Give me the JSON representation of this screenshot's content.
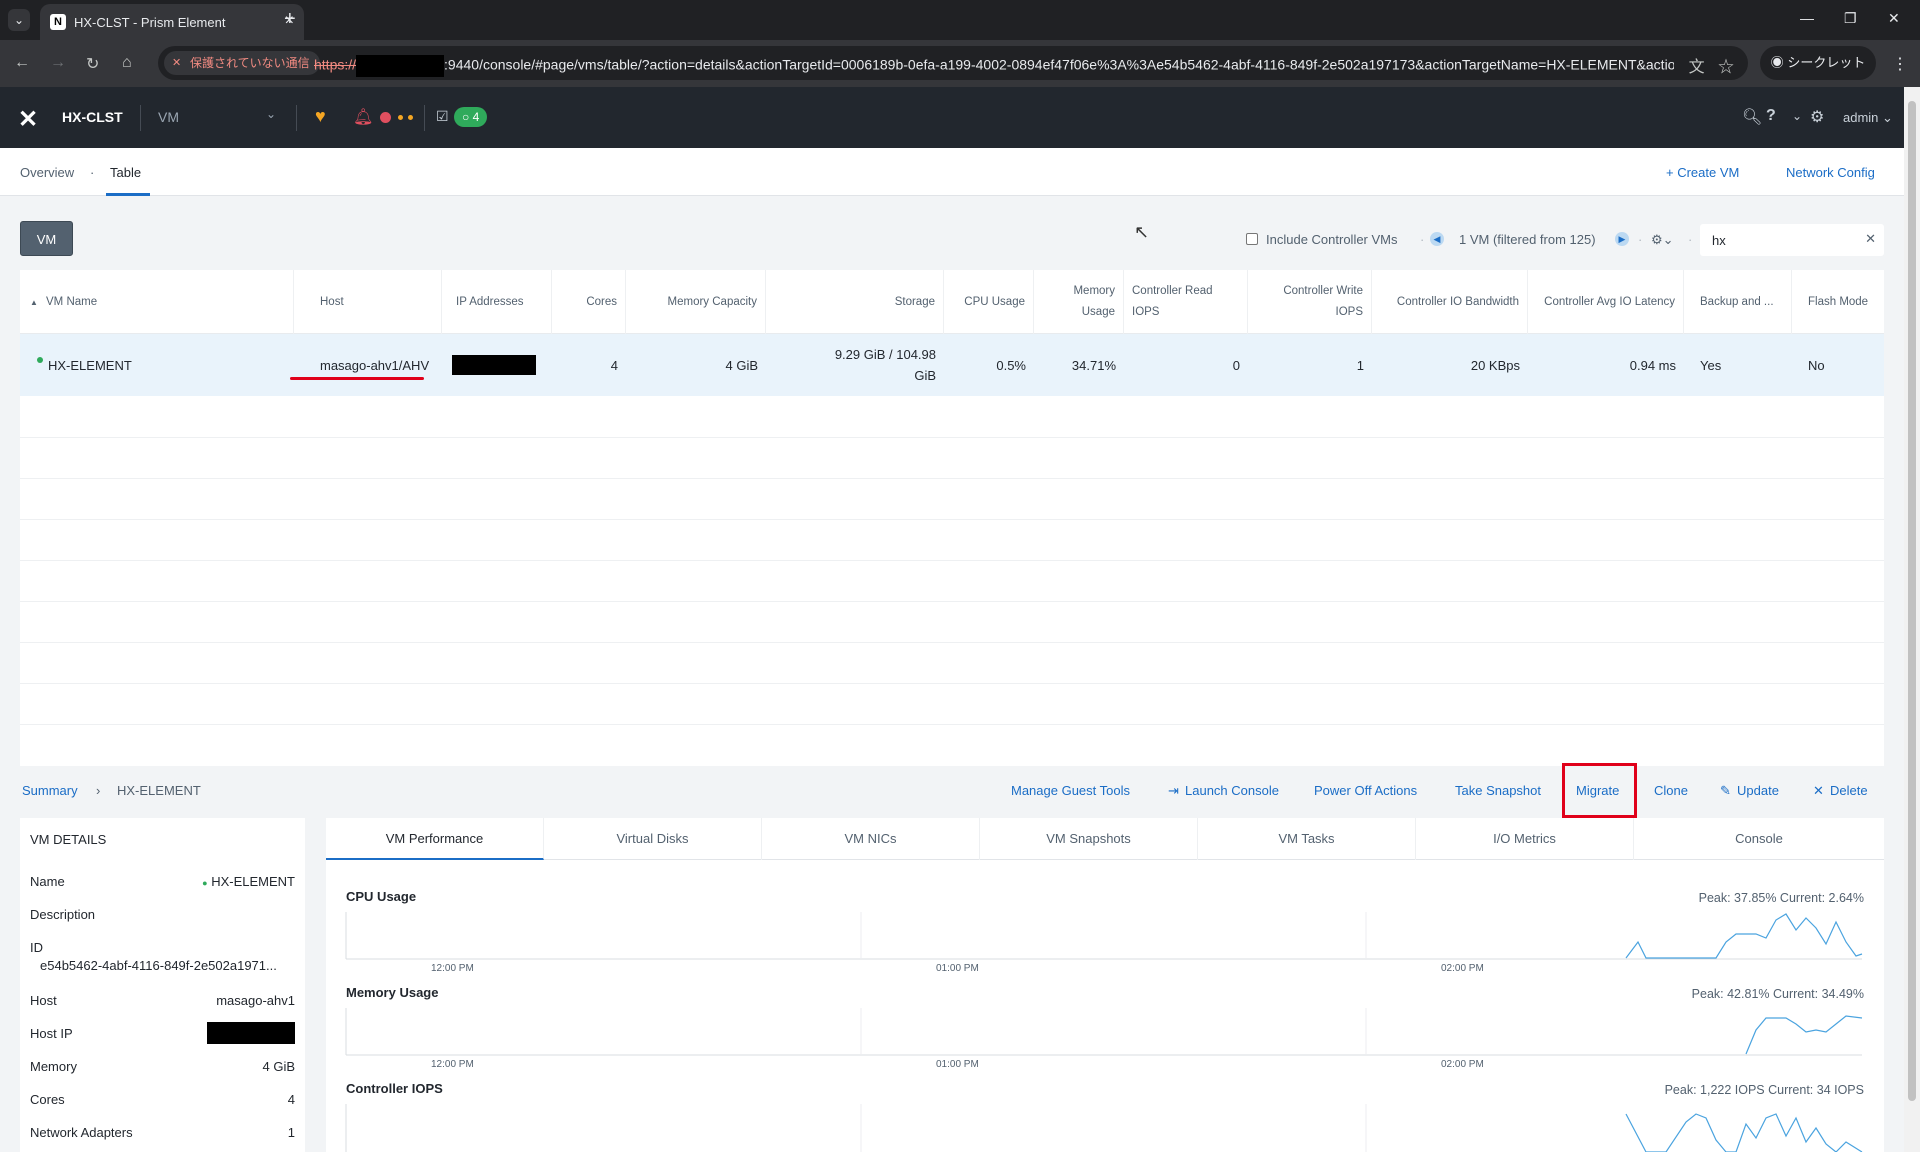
{
  "browser": {
    "tab_title": "HX-CLST - Prism Element",
    "insecure_label": "保護されていない通信",
    "url_proto": "https://",
    "url_rest": ":9440/console/#page/vms/table/?action=details&actionTargetId=0006189b-0efa-a199-4002-0894ef47f06e%3A%3Ae54b5462-4abf-4116-849f-2e502a197173&actionTargetName=HX-ELEMENT&actio...",
    "incognito_label": "シークレット"
  },
  "header": {
    "cluster": "HX-CLST",
    "view": "VM",
    "tasks_count": "4",
    "user": "admin"
  },
  "subnav": {
    "overview": "Overview",
    "table": "Table",
    "create_vm": "+ Create VM",
    "network_config": "Network Config"
  },
  "filter": {
    "vm_button": "VM",
    "include_controller": "Include Controller VMs",
    "count_text": "1 VM (filtered from 125)",
    "search_value": "hx"
  },
  "table": {
    "columns": [
      "VM Name",
      "Host",
      "IP Addresses",
      "Cores",
      "Memory Capacity",
      "Storage",
      "CPU Usage",
      "Memory Usage",
      "Controller Read IOPS",
      "Controller Write IOPS",
      "Controller IO Bandwidth",
      "Controller Avg IO Latency",
      "Backup and ...",
      "Flash Mode"
    ],
    "row": {
      "name": "HX-ELEMENT",
      "host": "masago-ahv1/AHV",
      "cores": "4",
      "memory": "4 GiB",
      "storage": "9.29 GiB / 104.98 GiB",
      "cpu": "0.5%",
      "mem_usage": "34.71%",
      "read_iops": "0",
      "write_iops": "1",
      "bandwidth": "20 KBps",
      "latency": "0.94 ms",
      "backup": "Yes",
      "flash": "No"
    }
  },
  "summary": {
    "crumb_root": "Summary",
    "crumb_vm": "HX-ELEMENT",
    "actions": {
      "manage_guest_tools": "Manage Guest Tools",
      "launch_console": "Launch Console",
      "power_off": "Power Off Actions",
      "snapshot": "Take Snapshot",
      "migrate": "Migrate",
      "clone": "Clone",
      "update": "Update",
      "delete": "Delete"
    }
  },
  "details": {
    "title": "VM DETAILS",
    "name_label": "Name",
    "name_value": "HX-ELEMENT",
    "desc_label": "Description",
    "id_label": "ID",
    "id_value": "e54b5462-4abf-4116-849f-2e502a1971...",
    "host_label": "Host",
    "host_value": "masago-ahv1",
    "hostip_label": "Host IP",
    "memory_label": "Memory",
    "memory_value": "4 GiB",
    "cores_label": "Cores",
    "cores_value": "4",
    "nics_label": "Network Adapters",
    "nics_value": "1"
  },
  "perf": {
    "tabs": [
      "VM Performance",
      "Virtual Disks",
      "VM NICs",
      "VM Snapshots",
      "VM Tasks",
      "I/O Metrics",
      "Console"
    ],
    "cpu_title": "CPU Usage",
    "cpu_stat": "Peak: 37.85%  Current: 2.64%",
    "mem_title": "Memory Usage",
    "mem_stat": "Peak: 42.81%  Current: 34.49%",
    "iops_title": "Controller IOPS",
    "iops_stat": "Peak: 1,222 IOPS  Current: 34 IOPS",
    "ticks": [
      "12:00 PM",
      "01:00 PM",
      "02:00 PM"
    ]
  },
  "colors": {
    "accent": "#1b6dc6",
    "header_bg": "#22272e",
    "highlight": "#e0001a",
    "spark": "#4aa3df"
  }
}
